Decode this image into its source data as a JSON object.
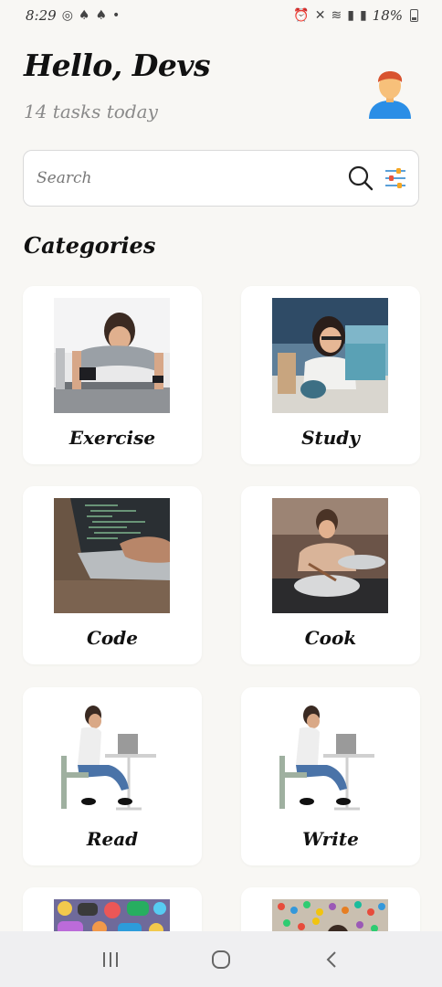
{
  "status_bar": {
    "time": "8:29",
    "battery": "18%"
  },
  "header": {
    "greeting": "Hello, Devs",
    "subtitle": "14 tasks today",
    "avatar_icon": "user-avatar-icon"
  },
  "search": {
    "placeholder": "Search",
    "value": "",
    "search_icon": "search-icon",
    "filter_icon": "filter-sliders-icon"
  },
  "categories": {
    "title": "Categories",
    "items": [
      {
        "label": "Exercise"
      },
      {
        "label": "Study"
      },
      {
        "label": "Code"
      },
      {
        "label": "Cook"
      },
      {
        "label": "Read"
      },
      {
        "label": "Write"
      }
    ]
  },
  "nav": {
    "recents_icon": "recents-icon",
    "home_icon": "home-icon",
    "back_icon": "back-icon"
  },
  "colors": {
    "background": "#f8f7f4",
    "card": "#ffffff",
    "text": "#111111",
    "muted": "#8a8a8a"
  }
}
